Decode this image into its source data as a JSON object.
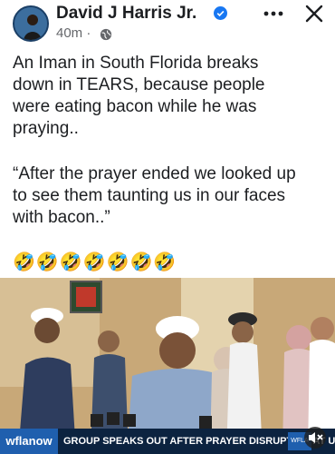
{
  "post": {
    "author": "David J Harris Jr.",
    "timestamp": "40m",
    "visibility_icon": "globe-icon",
    "text_lines": [
      "An Iman in South Florida breaks",
      "down in TEARS, because people",
      "were eating bacon while he was",
      "praying.."
    ],
    "quote_lines": [
      "“After the prayer ended we looked up",
      "to see them taunting us in our faces",
      "with bacon..”"
    ],
    "emojis": "🤣🤣🤣🤣🤣🤣🤣"
  },
  "video": {
    "ticker_logo": "wflanow",
    "headline": "GROUP SPEAKS OUT AFTER PRAYER DISRUPTION AT USF",
    "badge": "WFLA"
  },
  "colors": {
    "verified_blue": "#1877f2",
    "ticker_bg": "#0c2340",
    "ticker_logo_bg": "#1f5fae"
  }
}
